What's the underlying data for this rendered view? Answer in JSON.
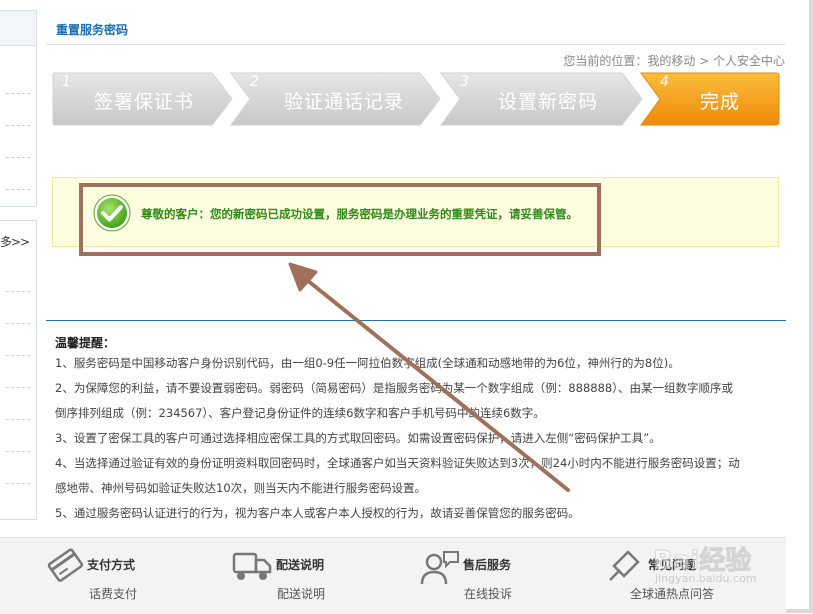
{
  "header": {
    "title": "重置服务密码",
    "location": "您当前的位置：我的移动 > 个人安全中心"
  },
  "sidebar": {
    "more_label": "多>>"
  },
  "steps": [
    {
      "num": "1",
      "label": "签署保证书",
      "state": "done"
    },
    {
      "num": "2",
      "label": "验证通话记录",
      "state": "done"
    },
    {
      "num": "3",
      "label": "设置新密码",
      "state": "done"
    },
    {
      "num": "4",
      "label": "完成",
      "state": "active"
    }
  ],
  "notice": {
    "text": "尊敬的客户：您的新密码已成功设置，服务密码是办理业务的重要凭证，请妥善保管。"
  },
  "tips": {
    "title": "温馨提醒：",
    "lines": [
      "1、服务密码是中国移动客户身份识别代码，由一组0-9任一阿拉伯数字组成(全球通和动感地带的为6位，神州行的为8位)。",
      "2、为保障您的利益，请不要设置弱密码。弱密码（简易密码）是指服务密码为某一个数字组成（例：888888）、由某一组数字顺序或",
      "倒序排列组成（例：234567）、客户登记身份证件的连续6数字和客户手机号码中的连续6数字。",
      "3、设置了密保工具的客户可通过选择相应密保工具的方式取回密码。如需设置密码保护，请进入左侧“密码保护工具”。",
      "4、当选择通过验证有效的身份证明资料取回密码时，全球通客户如当天资料验证失败达到3次，则24小时内不能进行服务密码设置；动",
      "感地带、神州号码如验证失败达10次，则当天内不能进行服务密码设置。",
      "5、通过服务密码认证进行的行为，视为客户本人或客户本人授权的行为，故请妥善保管您的服务密码。"
    ]
  },
  "services": [
    {
      "title": "支付方式",
      "link": "话费支付",
      "icon": "payment-card-icon"
    },
    {
      "title": "配送说明",
      "link": "配送说明",
      "icon": "delivery-truck-icon"
    },
    {
      "title": "售后服务",
      "link": "在线投诉",
      "icon": "customer-service-icon"
    },
    {
      "title": "常见问题",
      "link": "全球通热点问答",
      "icon": "faq-icon"
    }
  ],
  "watermark": {
    "brand": "Bai经验",
    "url": "jingyan.baidu.com"
  },
  "colors": {
    "step_done": "#d6d6d6",
    "step_active": "#f7a21b",
    "notice_bg": "#fffde0",
    "notice_text": "#2e8b17",
    "annotation": "#a0715a",
    "title_blue": "#1a6fb0"
  }
}
